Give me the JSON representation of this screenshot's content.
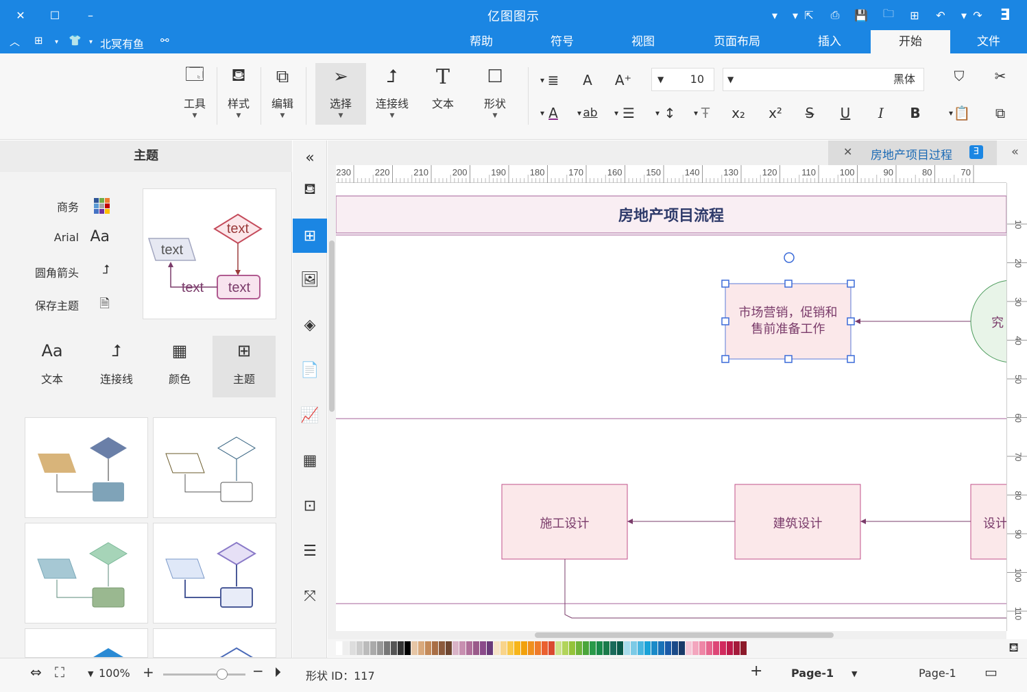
{
  "app": {
    "title": "亿图图示",
    "user": "北冥有鱼"
  },
  "menu": {
    "tabs": [
      "文件",
      "开始",
      "插入",
      "页面布局",
      "视图",
      "符号",
      "帮助"
    ],
    "active_tab": "开始"
  },
  "ribbon": {
    "font_name": "黑体",
    "font_size": "10",
    "groups": [
      {
        "name": "shape",
        "label": "形状",
        "icon": "square-outline-icon"
      },
      {
        "name": "text",
        "label": "文本",
        "icon": "text-t-icon"
      },
      {
        "name": "connector",
        "label": "连接线",
        "icon": "connector-elbow-icon"
      },
      {
        "name": "select",
        "label": "选择",
        "icon": "cursor-arrow-icon"
      },
      {
        "name": "edit",
        "label": "编辑",
        "icon": "edit-frame-icon"
      },
      {
        "name": "style",
        "label": "样式",
        "icon": "paint-bucket-icon"
      },
      {
        "name": "tools",
        "label": "工具",
        "icon": "tools-icon"
      }
    ]
  },
  "left_panel": {
    "title": "主题",
    "theme_options": [
      {
        "label": "商务",
        "icon": "color-grid-icon"
      },
      {
        "label": "Arial",
        "icon": "font-aa-icon",
        "glyph": "Aa"
      },
      {
        "label": "圆角箭头",
        "icon": "rounded-arrow-icon"
      },
      {
        "label": "保存主题",
        "icon": "save-theme-icon"
      }
    ],
    "preview_texts": [
      "text",
      "text",
      "text",
      "text"
    ],
    "sub_tabs": [
      {
        "label": "主题",
        "icon": "theme-grid-icon"
      },
      {
        "label": "颜色",
        "icon": "color-table-icon"
      },
      {
        "label": "连接线",
        "icon": "connector-icon"
      },
      {
        "label": "文本",
        "icon": "text-aa-icon",
        "glyph": "Aa"
      }
    ]
  },
  "document": {
    "tab_title": "房地产项目过程",
    "diagram_title": "房地产项目流程",
    "nodes": [
      {
        "text_line1": "市场营销，促销和",
        "text_line2": "售前准备工作"
      },
      {
        "text": "施工设计"
      },
      {
        "text": "建筑设计"
      },
      {
        "text": "设计"
      },
      {
        "text": "究"
      }
    ]
  },
  "ruler": {
    "h_ticks": [
      "70",
      "80",
      "90",
      "100",
      "110",
      "120",
      "130",
      "140",
      "150",
      "160",
      "170",
      "180",
      "190",
      "200",
      "210",
      "220",
      "230"
    ],
    "v_ticks": [
      "10",
      "20",
      "30",
      "40",
      "50",
      "60",
      "70",
      "80",
      "90",
      "100",
      "110"
    ]
  },
  "palette_colors": [
    "#ffffff",
    "#eeeeee",
    "#dddddd",
    "#cccccc",
    "#bbbbbb",
    "#aaaaaa",
    "#999999",
    "#777777",
    "#555555",
    "#333333",
    "#000000",
    "#e6c6a6",
    "#d9a97c",
    "#c48a59",
    "#a96e45",
    "#8b5a3c",
    "#6e4630",
    "#d9b3c7",
    "#c78fb0",
    "#b06f9a",
    "#9a5a8a",
    "#8a4a8a",
    "#6a3a7a",
    "#f7e4c8",
    "#f9d48a",
    "#f9c84a",
    "#f7b51a",
    "#f2a10c",
    "#f0901e",
    "#ee7b2a",
    "#ea6030",
    "#d94a30",
    "#cde28a",
    "#b2d45a",
    "#94c33a",
    "#6fb43a",
    "#4aa53a",
    "#2a9a4a",
    "#1a8a4a",
    "#1a7a4a",
    "#1a6a5a",
    "#0a5a4a",
    "#a8dcec",
    "#7ccae6",
    "#4ab6e0",
    "#1aa2d8",
    "#1a8ac8",
    "#1a72b8",
    "#1a5aa8",
    "#1a4a88",
    "#1a3a68",
    "#f6c6d6",
    "#f3a6be",
    "#ee86a6",
    "#e6668e",
    "#dd4676",
    "#d12a5e",
    "#bc1a4a",
    "#a41a3a",
    "#8c1a2a"
  ],
  "status": {
    "page_label": "Page-1",
    "page_tab": "Page-1",
    "shape_id": "形状 ID：117",
    "zoom": "100%"
  }
}
